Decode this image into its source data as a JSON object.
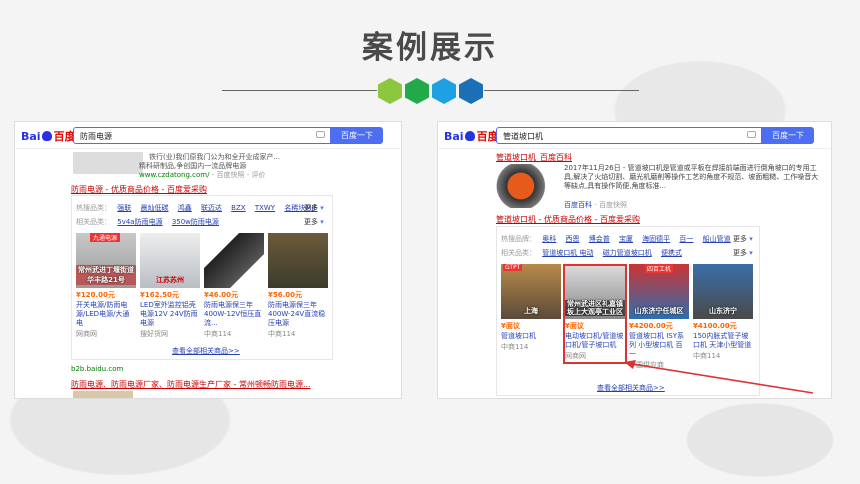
{
  "page": {
    "title": "案例展示"
  },
  "colors": {
    "hex1": "#8dc63f",
    "hex2": "#21a94a",
    "hex3": "#1da1e2",
    "hex4": "#1c6fb6",
    "accent_red": "#d33"
  },
  "left": {
    "logo": {
      "bai": "Bai",
      "du": "百度"
    },
    "search": {
      "query": "防雨电源",
      "button": "百度一下"
    },
    "top": {
      "line1": "铁行(业)我们原我门公为和全开业成家产...",
      "line2": "精科研制品,争创国内一流品牌电源",
      "url": "www.czdatong.com/",
      "sep": "- 百度快照",
      "eval": "- 评价"
    },
    "result_title": "防雨电源 - 优质商品价格 - 百度爱采购",
    "hot_label": "热搜品类：",
    "hot": [
      "强联",
      "晨灿低碳",
      "鸿鑫",
      "联迈达",
      "BZX",
      "TXWY",
      "名稀块MJF"
    ],
    "more": "更多",
    "rel_label": "相关品类：",
    "rel": [
      "5v4a防雨电源",
      "350w防雨电源"
    ],
    "products": [
      {
        "price": "¥120.00元",
        "name": "开关电源/防雨电源/LED电源/大通电",
        "shop": "网商网",
        "cap": "常州武进丁堰街道华丰路21号",
        "tag": "九通电源"
      },
      {
        "price": "¥162.50元",
        "name": "LED室外监控铝壳电源12V 24V防雨电源",
        "shop": "搜好货网",
        "cap": "江苏苏州",
        "tag": ""
      },
      {
        "price": "¥46.00元",
        "name": "防雨电源保三年400W-12V恒压直流...",
        "shop": "中商114",
        "cap": "",
        "tag": ""
      },
      {
        "price": "¥56.00元",
        "name": "防雨电源保三年400W-24V直流稳压电源",
        "shop": "中商114",
        "cap": "",
        "tag": ""
      }
    ],
    "view_all": "查看全部相关商品>>",
    "b2b": "b2b.baidu.com",
    "bottom_title": "防雨电源、防雨电源厂家、防雨电源生产厂家 - 常州顿畅防雨电源..."
  },
  "right": {
    "logo": {
      "bai": "Bai",
      "du": "百度"
    },
    "search": {
      "query": "管道坡口机",
      "button": "百度一下"
    },
    "baike_title": "管道坡口机_百度百科",
    "baike_text": "2017年11月26日 - 管道坡口机是管道或平板在焊接前端面进行倒角坡口的专用工具,解决了火焰切割、磨光机磨削等操作工艺的角度不规范、坡面粗糙、工作噪音大等缺点,具有操作简便,角度标准...",
    "baike_src": "百度百科",
    "baike_snap": "- 百度快照",
    "result_title": "管道坡口机 - 优质商品价格 - 百度爱采购",
    "hot_label": "热搜品牌：",
    "hot": [
      "奥科",
      "西恩",
      "博会普",
      "宝厦",
      "海固德平",
      "百一",
      "船山管道"
    ],
    "more": "更多",
    "rel_label": "相关品类：",
    "rel": [
      "管道坡口机 电动",
      "磁力管道坡口机",
      "便携式"
    ],
    "products": [
      {
        "price": "¥面议",
        "name": "管道坡口机",
        "shop": "中商114",
        "cap": "上海",
        "tag": "GTPT"
      },
      {
        "price": "¥面议",
        "name": "电动坡口机/管道坡口机/管子坡口机",
        "shop": "网商网",
        "cap": "常州武进区礼嘉镇坂上大观亭工业区",
        "tag": ""
      },
      {
        "price": "¥4200.00元",
        "name": "管道坡口机 ISY系列 小型坡口机 百一",
        "shop": "中国供应商",
        "cap": "山东济宁任城区",
        "tag": "四百工机"
      },
      {
        "price": "¥4100.00元",
        "name": "150内胀式管子坡口机 天津小型管道",
        "shop": "中商114",
        "cap": "山东济宁",
        "tag": ""
      }
    ],
    "view_all": "查看全部相关商品>>"
  }
}
